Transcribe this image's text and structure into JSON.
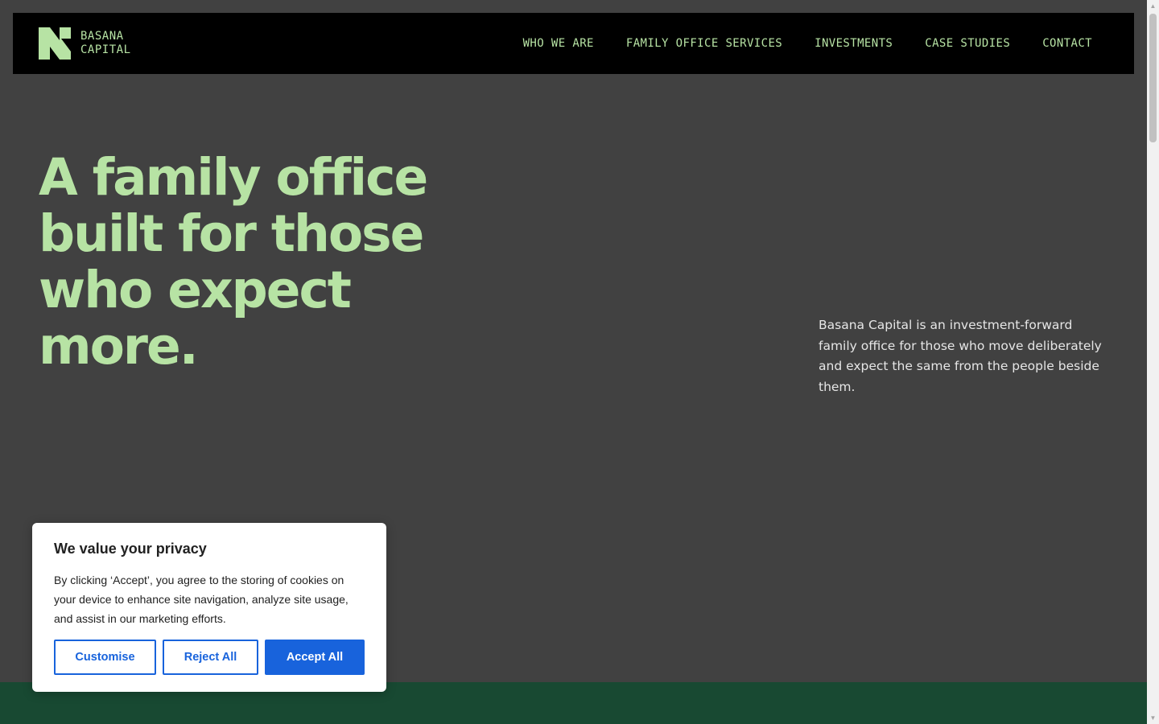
{
  "brand": {
    "line1": "BASANA",
    "line2": "CAPITAL",
    "accent_color": "#b7e3a4"
  },
  "nav": {
    "items": [
      "WHO WE ARE",
      "FAMILY OFFICE SERVICES",
      "INVESTMENTS",
      "CASE STUDIES",
      "CONTACT"
    ]
  },
  "hero": {
    "title": "A family office built for those who expect more.",
    "description": "Basana Capital is an investment-forward family office for those who move deliberately and expect the same from the people beside them."
  },
  "cookie_banner": {
    "title": "We value your privacy",
    "body": "By clicking ‘Accept’, you agree to the storing of cookies on your device to enhance site navigation, analyze site usage, and assist in our marketing efforts.",
    "customise_label": "Customise",
    "reject_label": "Reject All",
    "accept_label": "Accept All",
    "button_color": "#1863dc"
  },
  "colors": {
    "background": "#414141",
    "navbar": "#000000",
    "band": "#184932"
  }
}
